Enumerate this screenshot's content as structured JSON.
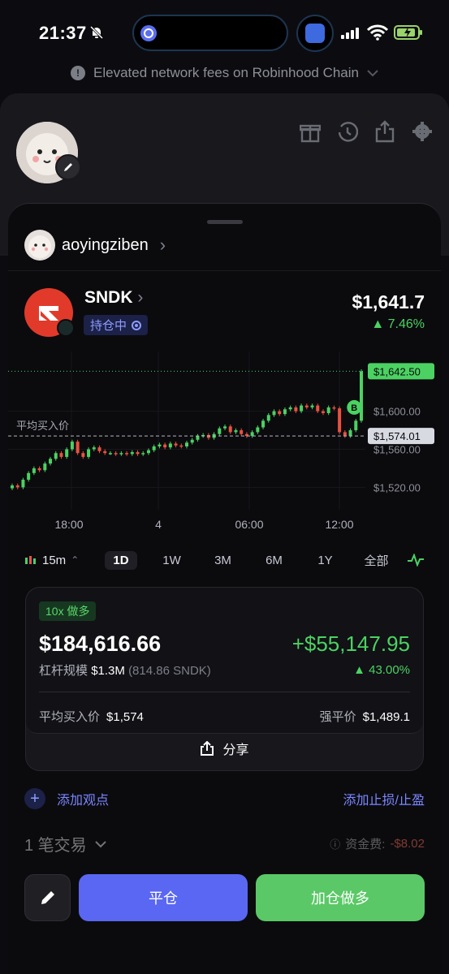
{
  "status": {
    "time": "21:37",
    "icons": [
      "bell-slash-icon",
      "signal-icon",
      "wifi-icon",
      "battery-charging-icon"
    ]
  },
  "banner": {
    "text": "Elevated network fees on Robinhood Chain",
    "icon": "exclamation-icon"
  },
  "background_profile": {
    "icons": [
      "gift-icon",
      "history-icon",
      "share-icon",
      "gear-icon"
    ]
  },
  "user": {
    "name": "aoyingziben"
  },
  "position": {
    "ticker": "SNDK",
    "status_badge": "持仓中",
    "price": "$1,641.7",
    "change": "▲ 7.46%"
  },
  "chart_data": {
    "type": "candlestick",
    "x_ticks": [
      "18:00",
      "4",
      "06:00",
      "12:00"
    ],
    "y_ticks": [
      "$1,600.00",
      "$1,560.00",
      "$1,520.00"
    ],
    "current_price_label": "$1,642.50",
    "avg_price_label": "$1,574.01",
    "avg_line_label": "平均买入价",
    "marker": "B",
    "ylim": [
      1505,
      1650
    ],
    "close_series": [
      1522,
      1520,
      1528,
      1535,
      1540,
      1538,
      1545,
      1550,
      1556,
      1552,
      1560,
      1568,
      1556,
      1552,
      1560,
      1562,
      1558,
      1556,
      1556,
      1555,
      1556,
      1555,
      1557,
      1555,
      1556,
      1559,
      1563,
      1565,
      1562,
      1566,
      1564,
      1563,
      1567,
      1570,
      1574,
      1575,
      1572,
      1576,
      1582,
      1584,
      1578,
      1580,
      1576,
      1574,
      1578,
      1583,
      1590,
      1596,
      1600,
      1597,
      1602,
      1604,
      1600,
      1606,
      1604,
      1606,
      1600,
      1598,
      1604,
      1603,
      1578,
      1574,
      1580,
      1590,
      1642
    ]
  },
  "timeframes": {
    "interval": "15m",
    "options": [
      "1D",
      "1W",
      "3M",
      "6M",
      "1Y",
      "全部"
    ],
    "active": "1D"
  },
  "card": {
    "leverage_badge": "10x 做多",
    "value": "$184,616.66",
    "pnl": "+$55,147.95",
    "leverage_label": "杠杆规模",
    "leverage_value": "$1.3M",
    "leverage_sub": "(814.86 SNDK)",
    "pnl_pct": "▲ 43.00%",
    "avg_label": "平均买入价",
    "avg_value": "$1,574",
    "liq_label": "强平价",
    "liq_value": "$1,489.1",
    "share": "分享"
  },
  "actions": {
    "add_note": "添加观点",
    "add_tpsl": "添加止损/止盈",
    "trades": "1 笔交易",
    "fee_label": "资金费:",
    "fee_value": "-$8.02",
    "close": "平仓",
    "add_long": "加仓做多"
  },
  "colors": {
    "up": "#4bd262",
    "down": "#e9523f",
    "accent": "#5a67f2"
  }
}
